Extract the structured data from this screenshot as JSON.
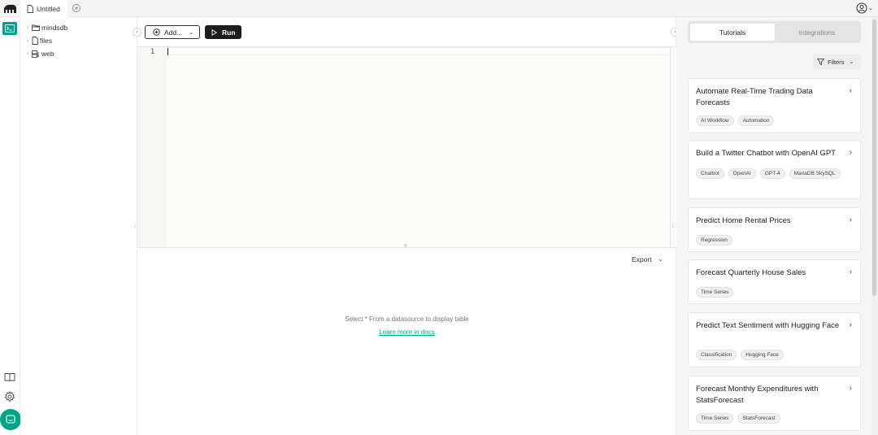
{
  "topbar": {
    "tab_title": "Untitled"
  },
  "tree": {
    "items": [
      {
        "label": "mindsdb"
      },
      {
        "label": "files"
      },
      {
        "label": "web"
      }
    ]
  },
  "toolbar": {
    "add_label": "Add...",
    "run_label": "Run"
  },
  "editor": {
    "line_numbers": [
      "1"
    ]
  },
  "results": {
    "export_label": "Export",
    "empty_message": "Select * From a datasource to display table",
    "docs_link": "Learn more in docs"
  },
  "panel": {
    "tabs": [
      {
        "label": "Tutorials",
        "active": true
      },
      {
        "label": "Integrations",
        "active": false
      }
    ],
    "filters_label": "Filters",
    "cards": [
      {
        "title": "Automate Real-Time Trading Data Forecasts",
        "tags": [
          "AI Workflow",
          "Automation"
        ]
      },
      {
        "title": "Build a Twitter Chatbot with OpenAI GPT",
        "tags": [
          "Chatbot",
          "OpenAI",
          "GPT-4",
          "MariaDB SkySQL"
        ]
      },
      {
        "title": "Predict Home Rental Prices",
        "tags": [
          "Regression"
        ]
      },
      {
        "title": "Forecast Quarterly House Sales",
        "tags": [
          "Time Series"
        ]
      },
      {
        "title": "Predict Text Sentiment with Hugging Face",
        "tags": [
          "Classification",
          "Hugging Face"
        ]
      },
      {
        "title": "Forecast Monthly Expenditures with StatsForecast",
        "tags": [
          "Time Series",
          "StatsForecast"
        ]
      }
    ]
  },
  "colors": {
    "accent": "#00a587",
    "run_button": "#1c1c1c"
  }
}
